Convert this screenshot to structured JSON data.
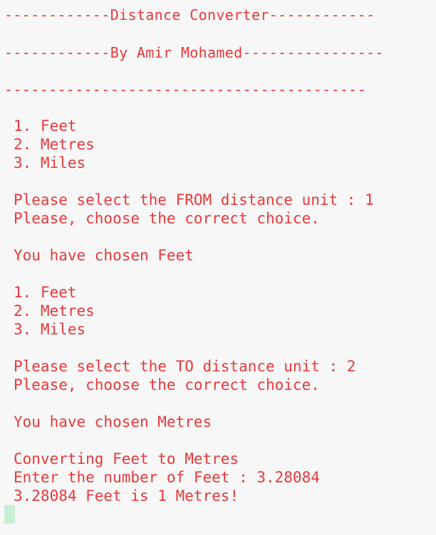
{
  "terminal": {
    "header": {
      "title_line": "------------Distance Converter------------",
      "author_line": "------------By Amir Mohamed----------------",
      "rule_line": "-----------------------------------------"
    },
    "first_menu": [
      "1. Feet",
      "2. Metres",
      "3. Miles"
    ],
    "from_prompt": "Please select the FROM distance unit : 1",
    "from_notice": "Please, choose the correct choice.",
    "from_chosen": "You have chosen Feet",
    "second_menu": [
      "1. Feet",
      "2. Metres",
      "3. Miles"
    ],
    "to_prompt": "Please select the TO distance unit : 2",
    "to_notice": "Please, choose the correct choice.",
    "to_chosen": "You have chosen Metres",
    "converting": "Converting Feet to Metres",
    "enter_prompt": "Enter the number of Feet : 3.28084",
    "result": "3.28084 Feet is 1 Metres!"
  },
  "colors": {
    "background": "#f7f7f7",
    "text": "#e8383a",
    "cursor": "#c8efd6"
  }
}
